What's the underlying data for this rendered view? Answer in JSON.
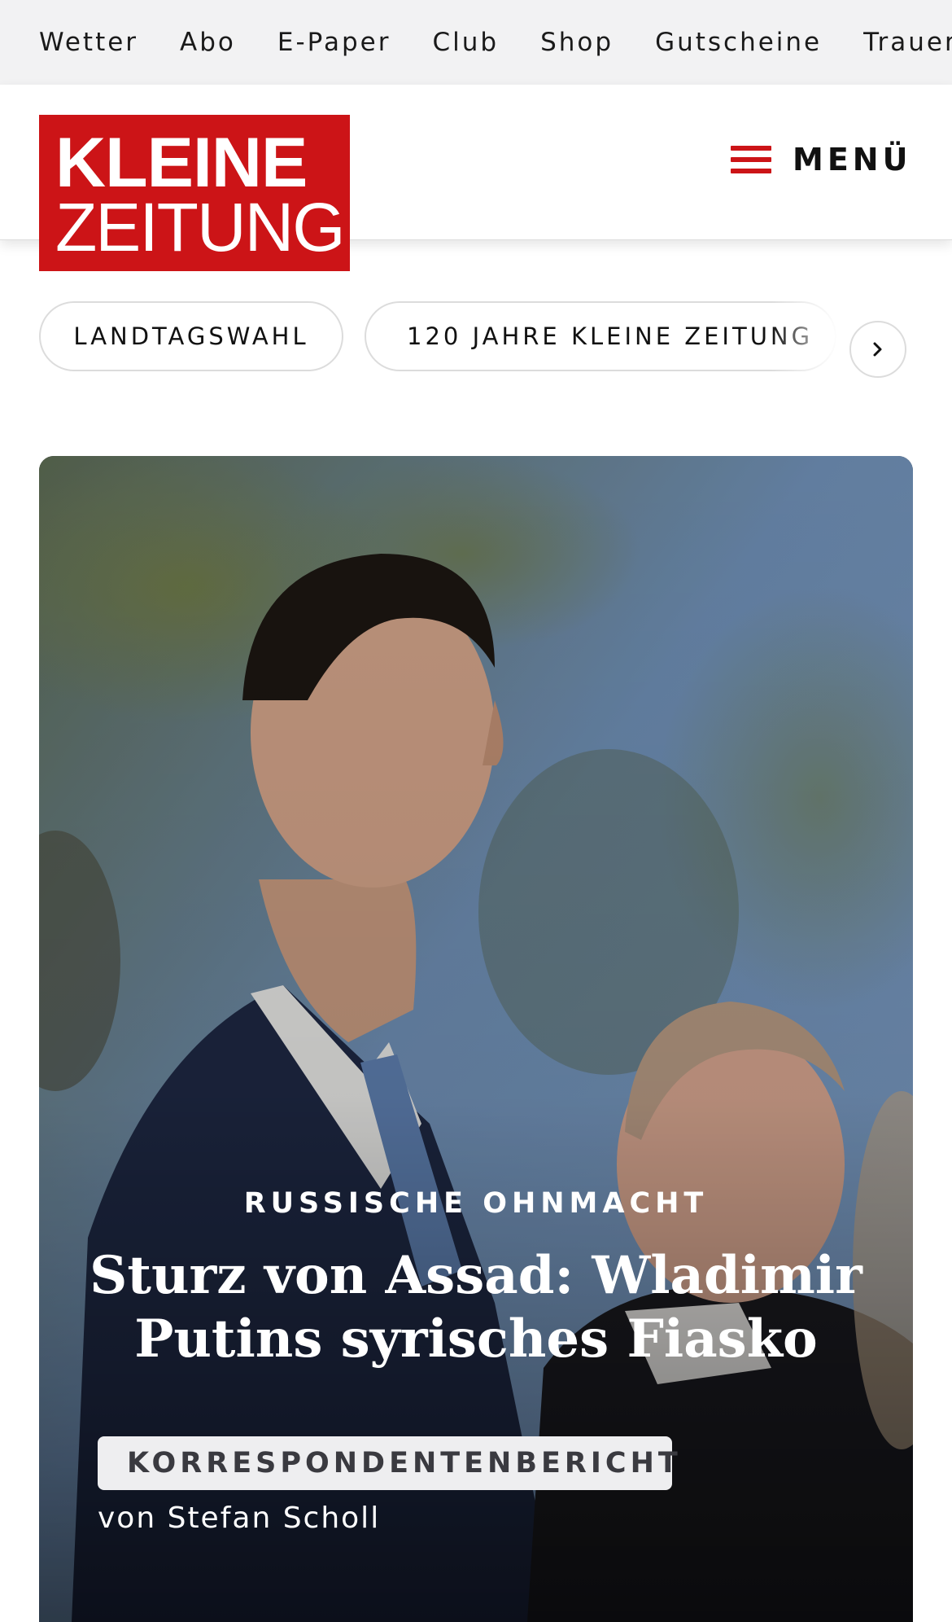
{
  "service_nav": {
    "items": [
      "Wetter",
      "Abo",
      "E-Paper",
      "Club",
      "Shop",
      "Gutscheine",
      "Trauerportal"
    ]
  },
  "logo": {
    "line1": "KLEINE",
    "line2": "ZEITUNG",
    "brand_color": "#cc1417"
  },
  "header": {
    "menu_label": "MENÜ",
    "menu_icon": "hamburger-icon"
  },
  "topics": {
    "pills": [
      "LANDTAGSWAHL",
      "120 JAHRE KLEINE ZEITUNG"
    ],
    "next_icon": "chevron-right-icon"
  },
  "hero": {
    "kicker": "RUSSISCHE OHNMACHT",
    "headline": "Sturz von Assad: Wladimir Putins syrisches Fiasko",
    "badge": "KORRESPONDENTENBERICHT",
    "author": "von Stefan Scholl"
  }
}
